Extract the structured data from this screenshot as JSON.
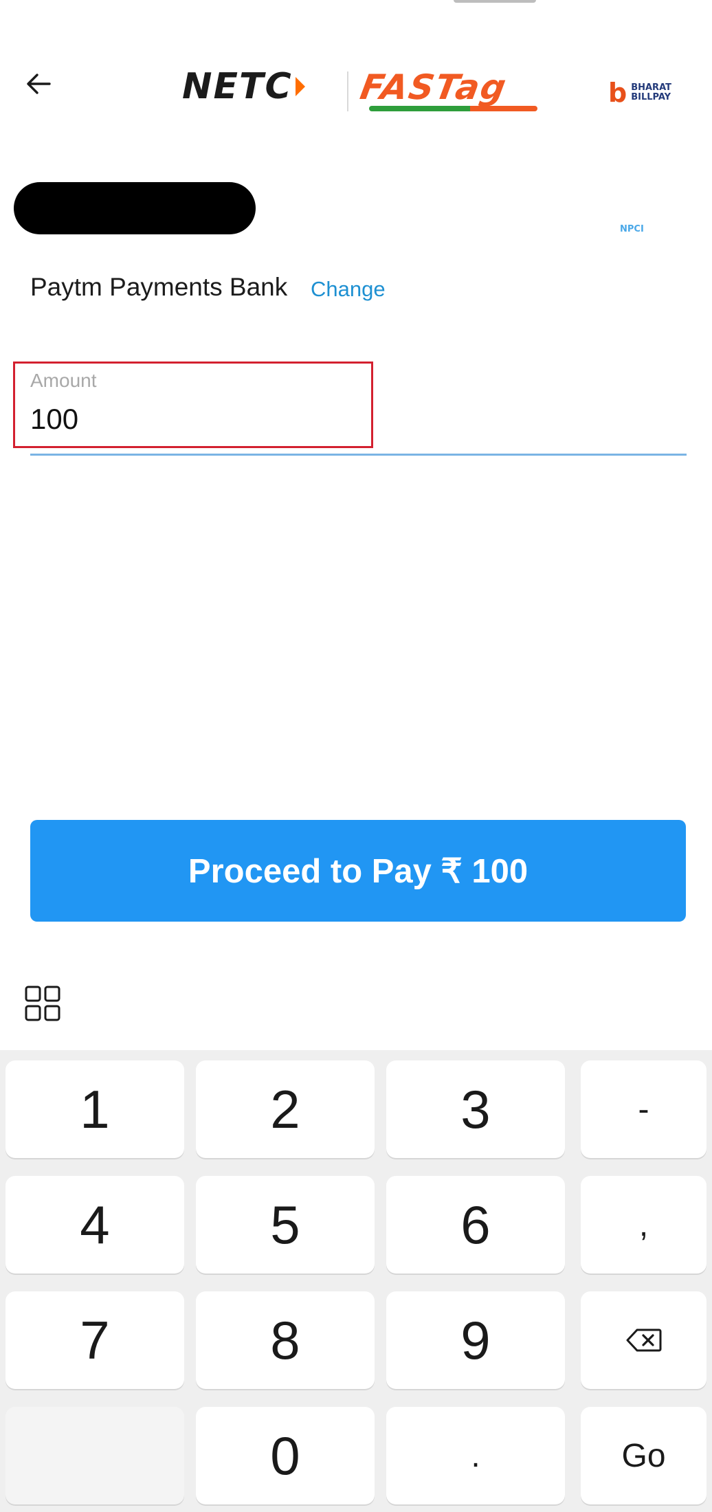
{
  "header": {
    "back_icon": "arrow-left-icon",
    "netc_logo_text": "NETC",
    "fastag_logo_text": "FASTag",
    "bbps_logo_text": [
      "BHARAT",
      "BILLPAY"
    ]
  },
  "account": {
    "provider_logo_text": "NPCI",
    "bank_name": "Paytm Payments Bank",
    "change_label": "Change"
  },
  "amount_field": {
    "label": "Amount",
    "value": "100"
  },
  "proceed_button": {
    "label": "Proceed to Pay ₹ 100"
  },
  "keyboard": {
    "toolbar_icon": "apps-grid-icon",
    "rows": [
      [
        "1",
        "2",
        "3",
        "-"
      ],
      [
        "4",
        "5",
        "6",
        ","
      ],
      [
        "7",
        "8",
        "9",
        "⌫"
      ],
      [
        "",
        "0",
        ".",
        "Go"
      ]
    ]
  },
  "colors": {
    "primary": "#2196f3",
    "link": "#1e90d2",
    "highlight_border": "#d3202f"
  }
}
